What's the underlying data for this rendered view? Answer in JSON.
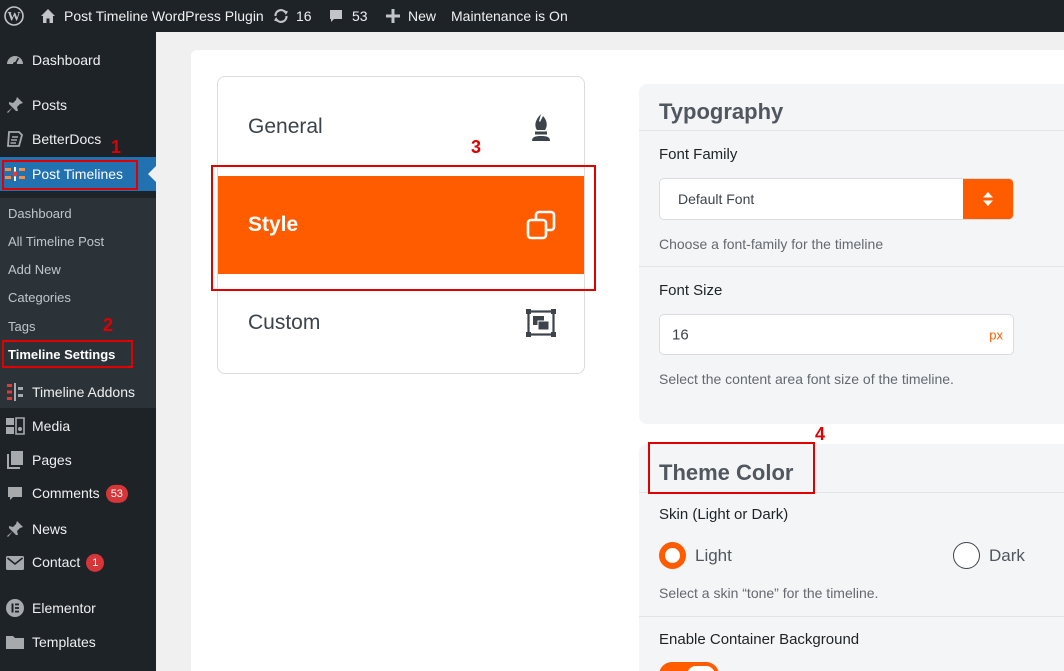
{
  "adminbar": {
    "site_name": "Post Timeline WordPress Plugin",
    "updates_count": "16",
    "comments_count": "53",
    "new_label": "New",
    "maintenance_label": "Maintenance is On"
  },
  "menu": {
    "items": [
      {
        "label": "Dashboard",
        "icon": "dashboard-icon"
      },
      {
        "label": "Posts",
        "icon": "pin-icon"
      },
      {
        "label": "BetterDocs",
        "icon": "betterdocs-icon"
      },
      {
        "label": "Post Timelines",
        "icon": "timeline-icon"
      },
      {
        "label": "Timeline Addons",
        "icon": "addons-icon"
      },
      {
        "label": "Media",
        "icon": "media-icon"
      },
      {
        "label": "Pages",
        "icon": "pages-icon"
      },
      {
        "label": "Comments",
        "icon": "comments-icon",
        "badge": "53"
      },
      {
        "label": "News",
        "icon": "pin-icon"
      },
      {
        "label": "Contact",
        "icon": "mail-icon",
        "badge": "1"
      },
      {
        "label": "Elementor",
        "icon": "elementor-icon"
      },
      {
        "label": "Templates",
        "icon": "folder-icon"
      }
    ],
    "submenu": [
      "Dashboard",
      "All Timeline Post",
      "Add New",
      "Categories",
      "Tags",
      "Timeline Settings"
    ]
  },
  "tabs": [
    {
      "label": "General",
      "icon": "chess-bishop-icon"
    },
    {
      "label": "Style",
      "icon": "copy-icon"
    },
    {
      "label": "Custom",
      "icon": "object-group-icon"
    }
  ],
  "typography": {
    "title": "Typography",
    "font_family_label": "Font Family",
    "font_family_value": "Default Font",
    "font_family_help": "Choose a font-family for the timeline",
    "font_size_label": "Font Size",
    "font_size_value": "16",
    "font_size_unit": "px",
    "font_size_help": "Select the content area font size of the timeline."
  },
  "theme_color": {
    "title": "Theme Color",
    "skin_label": "Skin (Light or Dark)",
    "option_light": "Light",
    "option_dark": "Dark",
    "selected": "Light",
    "skin_help": "Select a skin “tone” for the timeline.",
    "container_bg_label": "Enable Container Background",
    "container_bg_enabled": true
  },
  "annotations": [
    "1",
    "2",
    "3",
    "4"
  ],
  "colors": {
    "accent": "#ff5c00",
    "wp_blue": "#2271b1",
    "annotation_red": "#e00000"
  }
}
